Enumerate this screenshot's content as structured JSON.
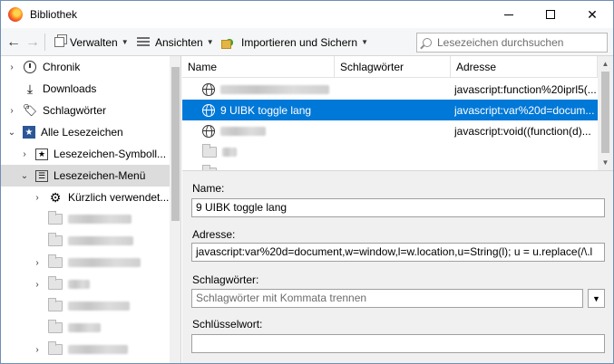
{
  "window": {
    "title": "Bibliothek",
    "controls": {
      "minimize": "minimize",
      "maximize": "maximize",
      "close": "✕"
    }
  },
  "toolbar": {
    "back": "←",
    "forward": "→",
    "verwalten": "Verwalten",
    "ansichten": "Ansichten",
    "importieren": "Importieren und Sichern",
    "search_placeholder": "Lesezeichen durchsuchen"
  },
  "sidebar": {
    "items": [
      {
        "label": "Chronik",
        "icon": "clock-icon",
        "twisty": "›"
      },
      {
        "label": "Downloads",
        "icon": "download-icon",
        "twisty": ""
      },
      {
        "label": "Schlagwörter",
        "icon": "tag-icon",
        "twisty": "›"
      },
      {
        "label": "Alle Lesezeichen",
        "icon": "star-folder-icon",
        "twisty": "⌄"
      },
      {
        "label": "Lesezeichen-Symboll...",
        "icon": "star-box-icon",
        "twisty": "›"
      },
      {
        "label": "Lesezeichen-Menü",
        "icon": "menu-list-icon",
        "twisty": "⌄"
      },
      {
        "label": "Kürzlich verwendet...",
        "icon": "gear-icon",
        "twisty": "›"
      }
    ]
  },
  "columns": {
    "name": "Name",
    "tags": "Schlagwörter",
    "address": "Adresse"
  },
  "rows": [
    {
      "name": "",
      "address": "javascript:function%20iprl5(..."
    },
    {
      "name": "9 UIBK toggle lang",
      "address": "javascript:var%20d=docum..."
    },
    {
      "name": "",
      "address": "javascript:void((function(d)..."
    }
  ],
  "details": {
    "name_label": "Name:",
    "name_value": "9 UIBK toggle lang",
    "address_label": "Adresse:",
    "address_value": "javascript:var%20d=document,w=window,l=w.location,u=String(l);  u = u.replace(/\\.l",
    "tags_label": "Schlagwörter:",
    "tags_placeholder": "Schlagwörter mit Kommata trennen",
    "keyword_label": "Schlüsselwort:",
    "keyword_value": ""
  },
  "colors": {
    "selection": "#0078d7",
    "toolbar": "#f5f6f7",
    "details": "#f0f0f0"
  }
}
